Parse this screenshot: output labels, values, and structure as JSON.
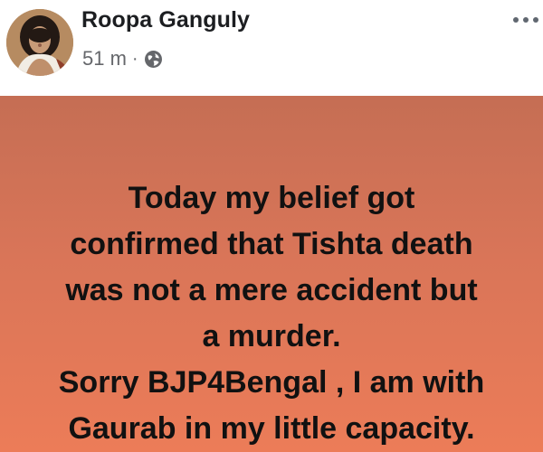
{
  "post": {
    "author": "Roopa Ganguly",
    "timestamp": "51 m",
    "separator": "·",
    "privacy_icon": "globe-icon",
    "more_icon": "more-options-icon"
  },
  "status": {
    "lines": [
      "Today my belief got",
      "confirmed that Tishta death",
      "was not a mere accident but",
      "a murder.",
      "Sorry BJP4Bengal , I am with",
      "Gaurab in my little capacity."
    ]
  },
  "colors": {
    "card_top": "#c56e54",
    "card_bottom": "#ec7c58",
    "name_text": "#1c1e21",
    "meta_text": "#65676b"
  }
}
